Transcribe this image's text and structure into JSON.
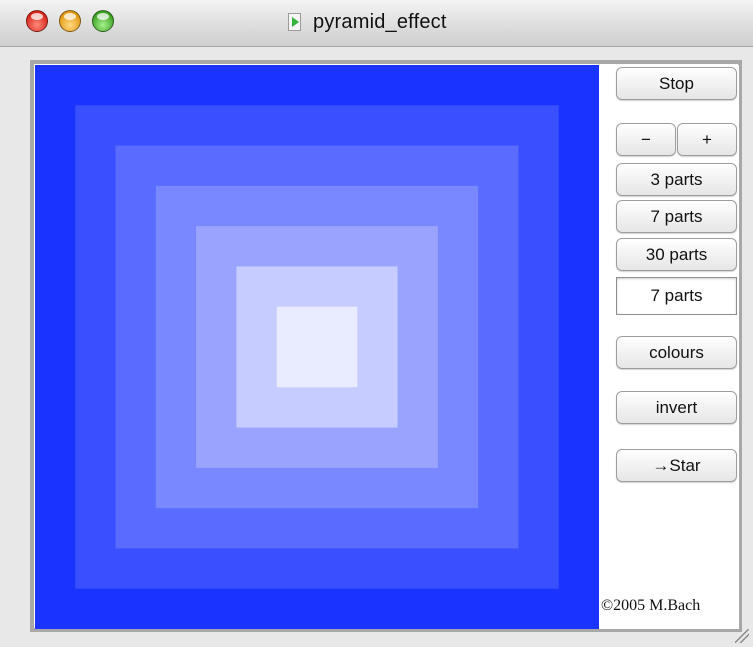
{
  "window": {
    "title": "pyramid_effect"
  },
  "colors": {
    "outer": "#1a33ff",
    "levels": [
      "#1a33ff",
      "#3a4fff",
      "#5a6cff",
      "#7a88ff",
      "#9aa4ff",
      "#c6ccff",
      "#e9ebff"
    ],
    "panel_background": "#ffffff"
  },
  "pyramid": {
    "levels": 7
  },
  "controls": {
    "stop_label": "Stop",
    "minus_label": "−",
    "plus_label": "+",
    "preset_3_label": "3 parts",
    "preset_7_label": "7 parts",
    "preset_30_label": "30 parts",
    "current_parts_value": "7 parts",
    "colours_label": "colours",
    "invert_label": "invert",
    "star_label": "→Star"
  },
  "footer": {
    "copyright": "©2005 M.Bach"
  }
}
